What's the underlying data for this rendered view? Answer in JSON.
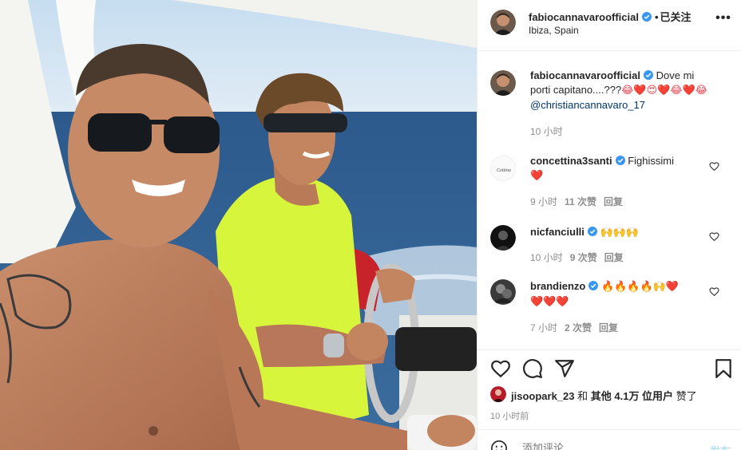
{
  "post": {
    "username": "fabiocannavaroofficial",
    "follow_separator": "•",
    "follow_status": "已关注",
    "location": "Ibiza, Spain",
    "more_icon": "more-horizontal-icon",
    "photo_alt": "Two men smiling on a boat at sea"
  },
  "caption": {
    "username": "fabiocannavaroofficial",
    "text_pre": "Dove mi porti capitano....???",
    "emojis": "😂❤️😍❤️😂❤️😂",
    "mention": "@christiancannavaro_17",
    "time": "10 小时"
  },
  "comments": [
    {
      "username": "concettina3santi",
      "text": "Fighissimi",
      "emojis": "❤️",
      "time": "9 小时",
      "likes": "11 次赞",
      "reply": "回复"
    },
    {
      "username": "nicfanciulli",
      "text": "",
      "emojis": "🙌🙌🙌",
      "time": "10 小时",
      "likes": "9 次赞",
      "reply": "回复"
    },
    {
      "username": "brandienzo",
      "text": "",
      "emojis": "🔥🔥🔥🔥🙌❤️",
      "emojis2": "❤️❤️❤️",
      "time": "7 小时",
      "likes": "2 次赞",
      "reply": "回复"
    }
  ],
  "actions": {
    "like_icon": "heart-icon",
    "comment_icon": "comment-icon",
    "share_icon": "send-icon",
    "save_icon": "bookmark-icon"
  },
  "likes": {
    "user": "jisoopark_23",
    "conj": "和",
    "others": "其他 4.1万 位用户",
    "suffix": "赞了"
  },
  "post_time": "10 小时前",
  "add_comment": {
    "placeholder": "添加评论...",
    "post_label": "发布"
  },
  "colors": {
    "verified": "#3897f0",
    "link": "#00376b",
    "meta": "#8e8e8e",
    "heart_red": "#ed4956",
    "neon_shirt": "#d7f53a"
  }
}
